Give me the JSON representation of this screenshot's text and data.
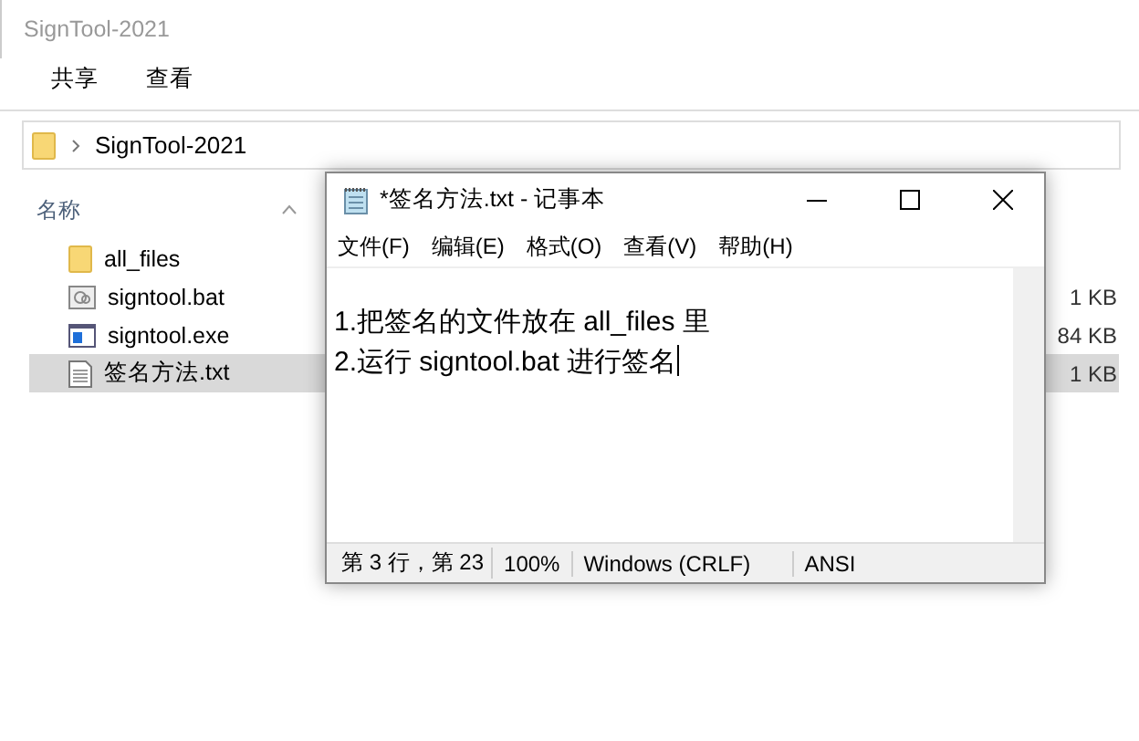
{
  "explorer": {
    "title": "SignTool-2021",
    "ribbon_tabs": [
      {
        "label": "共享",
        "selected": false
      },
      {
        "label": "查看",
        "selected": false
      }
    ],
    "address": "SignTool-2021",
    "columns": {
      "name": "名称"
    },
    "files": [
      {
        "kind": "folder",
        "name": "all_files",
        "selected": false
      },
      {
        "kind": "bat",
        "name": "signtool.bat",
        "size": "1 KB",
        "selected": false
      },
      {
        "kind": "exe",
        "name": "signtool.exe",
        "size": "84 KB",
        "selected": false
      },
      {
        "kind": "txt",
        "name": "签名方法.txt",
        "size": "1 KB",
        "selected": true
      }
    ]
  },
  "notepad": {
    "title": "*签名方法.txt - 记事本",
    "menu": [
      "文件(F)",
      "编辑(E)",
      "格式(O)",
      "查看(V)",
      "帮助(H)"
    ],
    "lines": [
      "1.把签名的文件放在 all_files 里",
      "2.运行 signtool.bat 进行签名"
    ],
    "status": [
      "第 3 行，第 23",
      "100%",
      "Windows (CRLF)",
      "ANSI"
    ]
  }
}
